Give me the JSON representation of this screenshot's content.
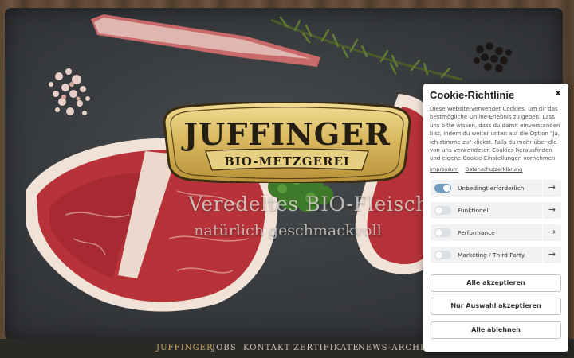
{
  "hero": {
    "logo_title": "JUFFINGER",
    "logo_subtitle": "BIO-METZGEREI",
    "tagline_main": "Veredeltes BIO-Fleisch",
    "tagline_sub": "natürlich geschmackvoll"
  },
  "nav": {
    "items": [
      "JUFFINGER",
      "JOBS",
      "KONTAKT",
      "ZERTIFIKATE",
      "NEWS-ARCHIV"
    ],
    "active_index": 0
  },
  "cookie": {
    "title": "Cookie-Richtlinie",
    "close_label": "x",
    "text": "Diese Website verwendet Cookies, um dir das bestmögliche Online-Erlebnis zu geben. Lass uns bitte wissen, dass du damit einverstanden bist, indem du weiter unten auf die Option \"Ja, ich stimme zu\" klickst. Falls du mehr über die von uns verwendeten Cookies herausfinden und eigene Cookie-Einstellungen vornehmen möchtest, klicke auf \"Cookie-Einstellungen\".",
    "links": {
      "impressum": "Impressum",
      "privacy": "Datenschutzerklärung"
    },
    "categories": [
      {
        "label": "Unbedingt erforderlich",
        "enabled": true
      },
      {
        "label": "Funktionell",
        "enabled": false
      },
      {
        "label": "Performance",
        "enabled": false
      },
      {
        "label": "Marketing / Third Party",
        "enabled": false
      }
    ],
    "arrow_glyph": "→",
    "buttons": {
      "accept_all": "Alle akzeptieren",
      "accept_selection": "Nur Auswahl akzeptieren",
      "reject_all": "Alle ablehnen"
    }
  },
  "colors": {
    "accent_gold": "#c9a964",
    "toggle_on": "#6f9cc0",
    "nav_bg": "#2b2926"
  }
}
